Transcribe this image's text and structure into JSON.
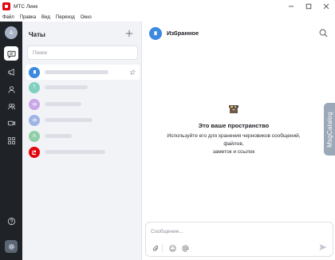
{
  "window": {
    "app_title": "МТС Линк",
    "controls": [
      "minimize-icon",
      "maximize-icon",
      "close-icon"
    ]
  },
  "menu": [
    "Файл",
    "Правка",
    "Вид",
    "Переход",
    "Окно"
  ],
  "rail": {
    "avatar_letter": "А",
    "items": [
      "chat-icon",
      "megaphone-icon",
      "user-icon",
      "contacts-icon",
      "video-icon",
      "apps-icon"
    ],
    "active_item": "chat-icon",
    "bottom": [
      "help-icon",
      "settings-icon"
    ]
  },
  "chat_list": {
    "title": "Чаты",
    "search_placeholder": "Поиск",
    "items": [
      {
        "avatar": "bookmark-icon",
        "avatar_color": "#3c8ae0",
        "selected": true,
        "pinned": true
      },
      {
        "avatar_letter": "Т",
        "avatar_color": "#7fd0c0"
      },
      {
        "avatar": "eye-icon",
        "avatar_color": "#c9a6e8"
      },
      {
        "avatar": "eye-icon",
        "avatar_color": "#9fb4e6"
      },
      {
        "avatar_letter": "А",
        "avatar_color": "#8fcfa8"
      },
      {
        "avatar": "mts-link-icon",
        "avatar_color": "#e30611"
      }
    ]
  },
  "conversation": {
    "title": "Избранное",
    "empty_title": "Это ваше пространство",
    "empty_desc_lines": [
      "Используйте его для хранения черновиков сообщений,",
      "файлов,",
      "заметок и ссылок"
    ],
    "side_tab": "MsgCatalog",
    "composer_placeholder": "Сообщение...",
    "composer_tools": [
      "attach-icon",
      "emoji-icon",
      "mention-icon",
      "send-icon"
    ]
  },
  "colors": {
    "rail_bg": "#1f2328",
    "accent_blue": "#3c8ae0",
    "brand_red": "#e30611",
    "side_tab": "#9aa8b8"
  }
}
